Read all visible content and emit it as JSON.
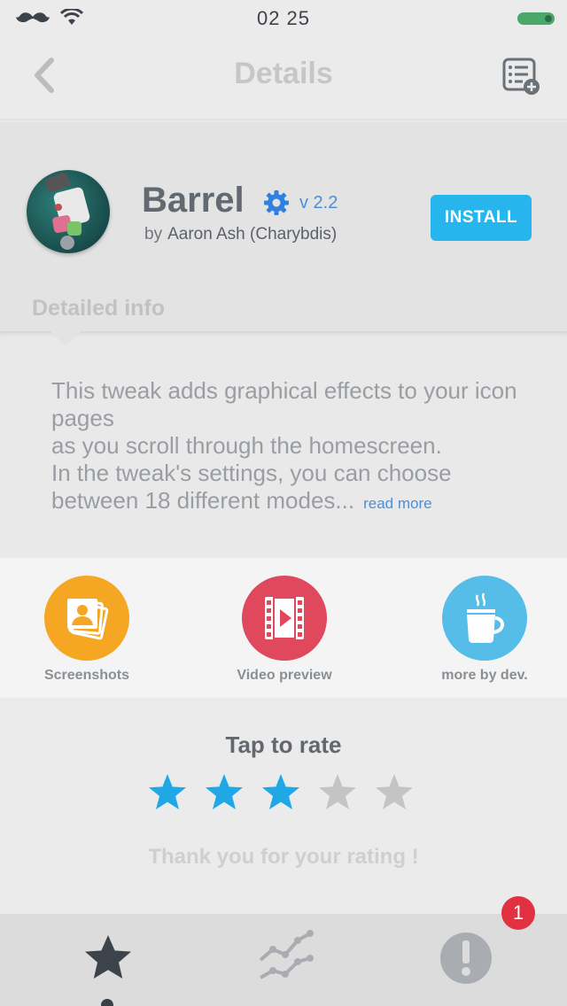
{
  "status_bar": {
    "time": "02 25"
  },
  "nav": {
    "title": "Details",
    "back_icon": "chevron-left-icon",
    "action_icon": "list-add-icon"
  },
  "app": {
    "name": "Barrel",
    "version": "v 2.2",
    "by_prefix": "by",
    "author": "Aaron Ash (Charybdis)",
    "install_label": "INSTALL"
  },
  "details": {
    "section_label": "Detailed info",
    "description": "This tweak adds graphical effects to your icon pages\nas you scroll through the homescreen.\nIn the tweak's settings, you can choose\nbetween 18 different modes...",
    "read_more": "read more"
  },
  "media": [
    {
      "label": "Screenshots",
      "icon": "photos-icon",
      "color": "#f5a623"
    },
    {
      "label": "Video preview",
      "icon": "film-icon",
      "color": "#e0485e"
    },
    {
      "label": "more by dev.",
      "icon": "coffee-cup-icon",
      "color": "#56bde8"
    }
  ],
  "rating": {
    "title": "Tap to rate",
    "value": 3,
    "max": 5,
    "active_color": "#1fa7e6",
    "inactive_color": "#c4c4c4",
    "thanks": "Thank you for your rating !"
  },
  "tabs": {
    "items": [
      {
        "icon": "star-icon"
      },
      {
        "icon": "trend-chart-icon"
      },
      {
        "icon": "alert-icon"
      }
    ],
    "badge_count": "1"
  }
}
